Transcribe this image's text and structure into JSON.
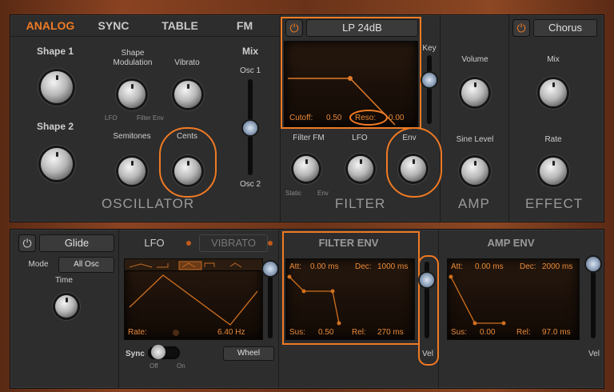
{
  "top": {
    "tabs": [
      "ANALOG",
      "SYNC",
      "TABLE",
      "FM"
    ],
    "active_tab": "ANALOG",
    "oscillator": {
      "shape1": "Shape 1",
      "shape2": "Shape 2",
      "shape_mod": "Shape\nModulation",
      "shape_mod_left": "LFO",
      "shape_mod_right": "Filter Env",
      "vibrato": "Vibrato",
      "semitones": "Semitones",
      "cents": "Cents",
      "mix": "Mix",
      "osc1": "Osc 1",
      "osc2": "Osc 2",
      "title": "OSCILLATOR"
    },
    "filter": {
      "type": "LP 24dB",
      "cutoff_label": "Cutoff:",
      "cutoff_val": "0.50",
      "reso_label": "Reso:",
      "reso_val": "0.00",
      "key": "Key",
      "filter_fm": "Filter FM",
      "lfo": "LFO",
      "env": "Env",
      "static": "Static",
      "env_small": "Env",
      "title": "FILTER"
    },
    "amp": {
      "volume": "Volume",
      "sine_level": "Sine Level",
      "title": "AMP"
    },
    "effect": {
      "type": "Chorus",
      "mix": "Mix",
      "rate": "Rate",
      "title": "EFFECT"
    }
  },
  "bottom": {
    "glide": {
      "title": "Glide",
      "mode_label": "Mode",
      "mode_value": "All Osc",
      "time": "Time"
    },
    "lfo": {
      "tab_lfo": "LFO",
      "tab_vibrato": "VIBRATO",
      "rate_label": "Rate:",
      "rate_value": "6.40 Hz",
      "sync": "Sync",
      "off": "Off",
      "on": "On",
      "wheel": "Wheel"
    },
    "filter_env": {
      "title": "FILTER ENV",
      "att_label": "Att:",
      "att_val": "0.00 ms",
      "dec_label": "Dec:",
      "dec_val": "1000 ms",
      "sus_label": "Sus:",
      "sus_val": "0.50",
      "rel_label": "Rel:",
      "rel_val": "270 ms",
      "vel": "Vel"
    },
    "amp_env": {
      "title": "AMP ENV",
      "att_label": "Att:",
      "att_val": "0.00 ms",
      "dec_label": "Dec:",
      "dec_val": "2000 ms",
      "sus_label": "Sus:",
      "sus_val": "0.00",
      "rel_label": "Rel:",
      "rel_val": "97.0 ms",
      "vel": "Vel"
    }
  },
  "colors": {
    "accent": "#f07a24",
    "panel": "#2d2d2d",
    "wood": "#7a3c1e"
  }
}
